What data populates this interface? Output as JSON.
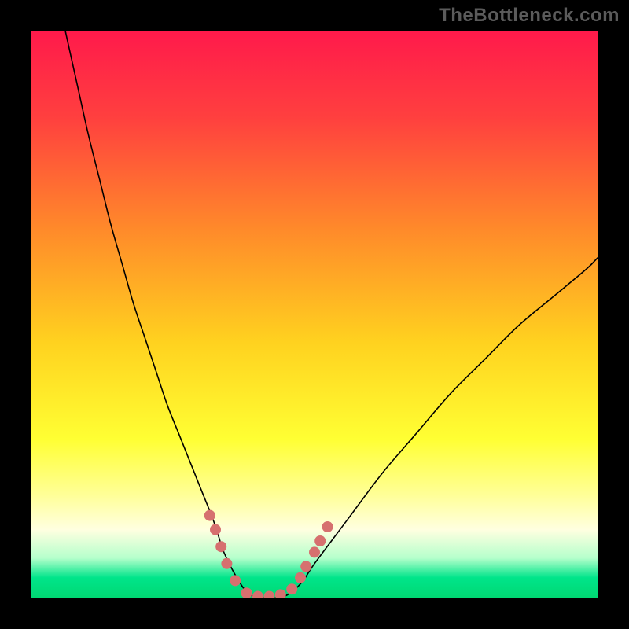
{
  "watermark": "TheBottleneck.com",
  "chart_data": {
    "type": "line",
    "title": "",
    "xlabel": "",
    "ylabel": "",
    "xlim": [
      0,
      100
    ],
    "ylim": [
      0,
      100
    ],
    "grid": false,
    "legend": false,
    "background_gradient_stops": [
      {
        "offset": 0.0,
        "color": "#ff1a4b"
      },
      {
        "offset": 0.15,
        "color": "#ff3f3f"
      },
      {
        "offset": 0.35,
        "color": "#ff8a2a"
      },
      {
        "offset": 0.55,
        "color": "#ffd21f"
      },
      {
        "offset": 0.72,
        "color": "#ffff33"
      },
      {
        "offset": 0.82,
        "color": "#ffff99"
      },
      {
        "offset": 0.88,
        "color": "#ffffe0"
      },
      {
        "offset": 0.93,
        "color": "#b6ffcc"
      },
      {
        "offset": 0.965,
        "color": "#00e58a"
      },
      {
        "offset": 1.0,
        "color": "#00d873"
      }
    ],
    "series": [
      {
        "name": "bottleneck-curve",
        "color": "#000000",
        "stroke_width": 1.6,
        "x": [
          6,
          8,
          10,
          12,
          14,
          16,
          18,
          20,
          22,
          24,
          26,
          28,
          30,
          32,
          33,
          34,
          36,
          38,
          40,
          42,
          44,
          46,
          48,
          50,
          56,
          62,
          68,
          74,
          80,
          86,
          92,
          98,
          100
        ],
        "y": [
          100,
          91,
          82,
          74,
          66,
          59,
          52,
          46,
          40,
          34,
          29,
          24,
          19,
          14,
          11,
          8,
          4,
          1,
          0,
          0,
          0,
          1,
          3,
          6,
          14,
          22,
          29,
          36,
          42,
          48,
          53,
          58,
          60
        ]
      }
    ],
    "markers": {
      "name": "highlight-dots",
      "color": "#d6706f",
      "radius": 7,
      "points": [
        {
          "x": 31.5,
          "y": 14.5
        },
        {
          "x": 32.5,
          "y": 12.0
        },
        {
          "x": 33.5,
          "y": 9.0
        },
        {
          "x": 34.5,
          "y": 6.0
        },
        {
          "x": 36.0,
          "y": 3.0
        },
        {
          "x": 38.0,
          "y": 0.8
        },
        {
          "x": 40.0,
          "y": 0.2
        },
        {
          "x": 42.0,
          "y": 0.2
        },
        {
          "x": 44.0,
          "y": 0.5
        },
        {
          "x": 46.0,
          "y": 1.5
        },
        {
          "x": 47.5,
          "y": 3.5
        },
        {
          "x": 48.5,
          "y": 5.5
        },
        {
          "x": 50.0,
          "y": 8.0
        },
        {
          "x": 51.0,
          "y": 10.0
        },
        {
          "x": 52.3,
          "y": 12.5
        }
      ]
    }
  }
}
